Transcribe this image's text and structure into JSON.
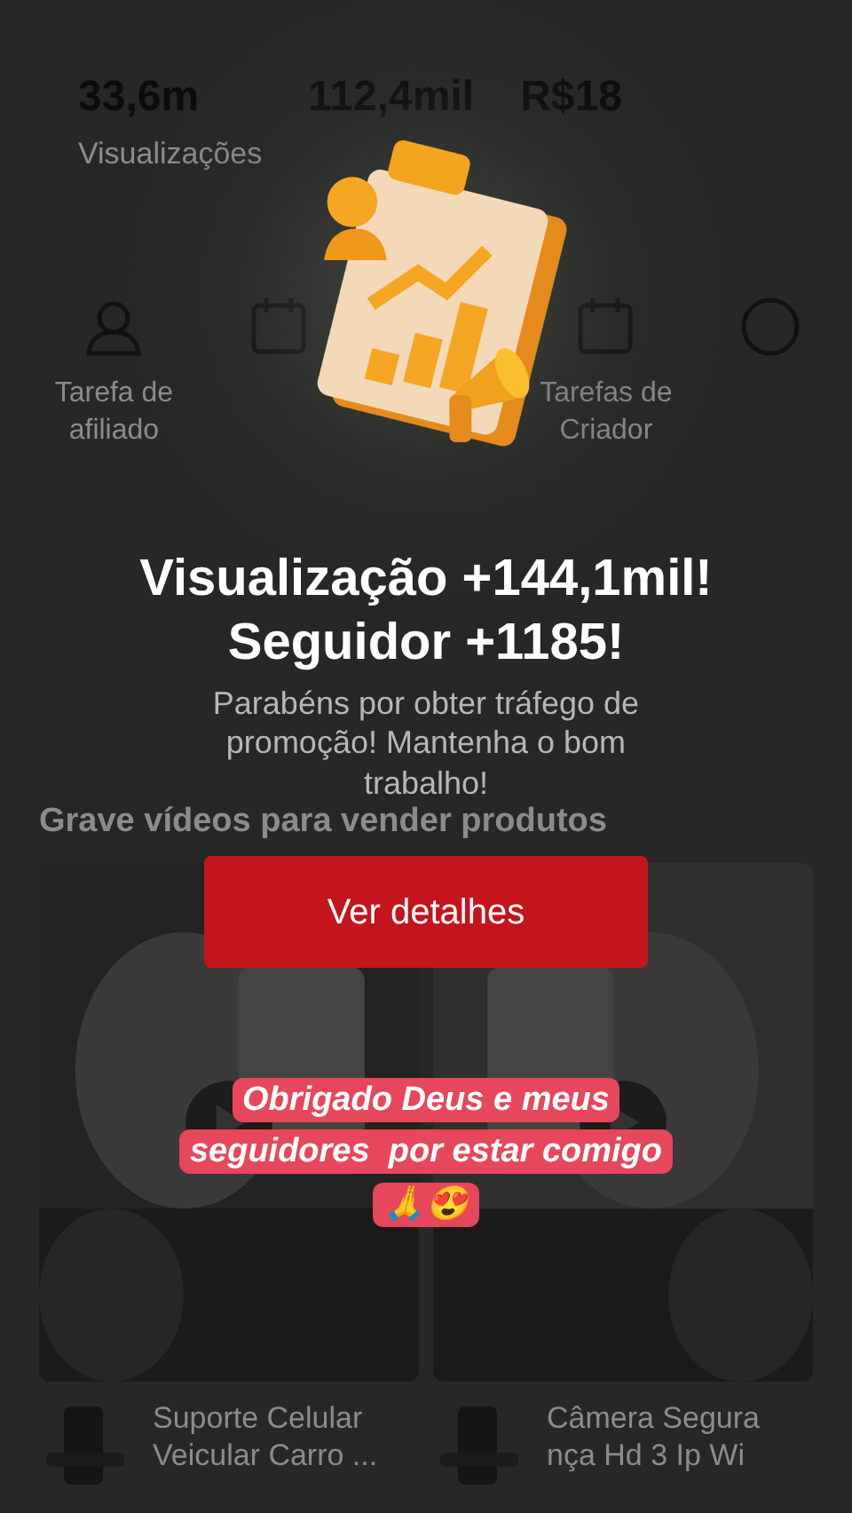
{
  "stats": [
    {
      "value": "33,6m",
      "label": "Visualizações"
    },
    {
      "value": "112,4mil"
    },
    {
      "value": "R$18"
    }
  ],
  "shortcuts": [
    {
      "label": "Tarefa de afiliado"
    },
    {
      "label": "Tarefas de Criador"
    }
  ],
  "feed": {
    "heading": "Grave vídeos para vender produtos",
    "products": [
      {
        "title": "Suporte Celular Veicular Carro ..."
      },
      {
        "title": "Câmera Segura nça Hd 3 Ip Wi"
      }
    ]
  },
  "modal": {
    "title_lines": [
      "Visualização +144,1mil!",
      "Seguidor +1185!"
    ],
    "message": "Parabéns por obter tráfego de promoção! Mantenha o bom trabalho!",
    "button": "Ver detalhes"
  },
  "caption": {
    "lines": [
      "Obrigado Deus e meus",
      "seguidores  por estar comigo",
      "🙏😍"
    ]
  }
}
